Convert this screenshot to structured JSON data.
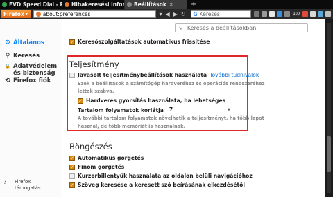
{
  "tabs": [
    {
      "title": "FVD Speed Dial - Pr",
      "close": "✕",
      "icon": "speeddial-icon",
      "color": "#34a853"
    },
    {
      "title": "Hibakeresési inform",
      "close": "✕",
      "icon": "firefox-icon",
      "color": "#e5792c"
    },
    {
      "title": "Beállítások",
      "close": "✕",
      "icon": "gear-icon",
      "color": "#8a8a8a"
    }
  ],
  "new_tab": "+",
  "navbar": {
    "menu_button": "Firefox",
    "menu_arrow": "▾",
    "url": "about:preferences",
    "search_placeholder": "Keresés",
    "search_engine": "G",
    "back": "◀",
    "forward": "▶",
    "reload": "↻",
    "dropdown": "▾",
    "badge": "100"
  },
  "sidebar": {
    "items": [
      {
        "label": "Általános",
        "icon": "gear-icon",
        "glyph": "⚙",
        "active": true
      },
      {
        "label": "Keresés",
        "icon": "search-icon",
        "glyph": "⚲",
        "active": false
      },
      {
        "label": "Adatvédelem és biztonság",
        "icon": "lock-icon",
        "glyph": "🔒",
        "active": false
      },
      {
        "label": "Firefox fiók",
        "icon": "sync-icon",
        "glyph": "⟲",
        "active": false
      }
    ],
    "help": {
      "label": "Firefox támogatás",
      "glyph": "?"
    }
  },
  "search_prefs": {
    "placeholder": "Keresés a beállításokban",
    "glyph": "⚲"
  },
  "top_option": {
    "label": "Keresőszolgáltatások automatikus frissítése",
    "checked": true
  },
  "performance": {
    "heading": "Teljesítmény",
    "recommended": {
      "label": "Javasolt teljesítménybeállítások használata",
      "link": "További tudnivalók",
      "checked": false
    },
    "recommended_note": [
      "Ezek a beállítások a számítógép hardveréhez és operációs rendszeréhez",
      "lettek szabva."
    ],
    "hw_accel": {
      "label": "Hardveres gyorsítás használata, ha lehetséges",
      "checked": true
    },
    "content_process": {
      "label": "Tartalom folyamatok korlátja",
      "value": "7",
      "caret": "▼"
    },
    "content_note": [
      "A további tartalom folyamatok növelhetik a teljesítményt, ha több lapot",
      "használ, de több memóriát is használnak."
    ]
  },
  "browsing": {
    "heading": "Böngészés",
    "options": [
      {
        "label": "Automatikus görgetés",
        "checked": true
      },
      {
        "label": "Finom görgetés",
        "checked": true
      },
      {
        "label": "Kurzorbillentyűk használata az oldalon belüli navigációhoz",
        "checked": false
      },
      {
        "label": "Szöveg keresése a keresett szó beírásának elkezdésétől",
        "checked": true
      }
    ]
  },
  "colors": {
    "accent": "#0a84ff",
    "checkbox": "#d9890e",
    "highlight": "#e02828"
  }
}
